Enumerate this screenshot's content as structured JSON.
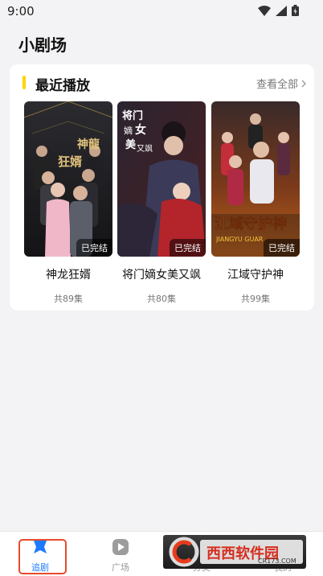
{
  "status": {
    "time": "9:00"
  },
  "page_title": "小剧场",
  "recent": {
    "title": "最近播放",
    "view_all": "查看全部",
    "items": [
      {
        "title": "神龙狂婿",
        "episodes": "共89集",
        "badge": "已完结",
        "poster_text": "神龍狂婿"
      },
      {
        "title": "将门嫡女美又飒",
        "episodes": "共80集",
        "badge": "已完结",
        "poster_text": "将门嫡女美又飒"
      },
      {
        "title": "江域守护神",
        "episodes": "共99集",
        "badge": "已完结",
        "poster_text": "江域守护神",
        "poster_subtext": "JIANGYU GUAR"
      }
    ]
  },
  "tabs": [
    {
      "label": "追剧",
      "icon": "star-icon",
      "active": true
    },
    {
      "label": "广场",
      "icon": "play-icon",
      "active": false
    },
    {
      "label": "分类",
      "icon": "grid-icon",
      "active": false
    },
    {
      "label": "我的",
      "icon": "user-icon",
      "active": false
    }
  ],
  "watermark": {
    "text": "西西软件园",
    "sub": "CR173.COM"
  },
  "colors": {
    "accent": "#1e7bff",
    "section_bar": "#ffd400",
    "highlight_outline": "#e74b2c"
  }
}
